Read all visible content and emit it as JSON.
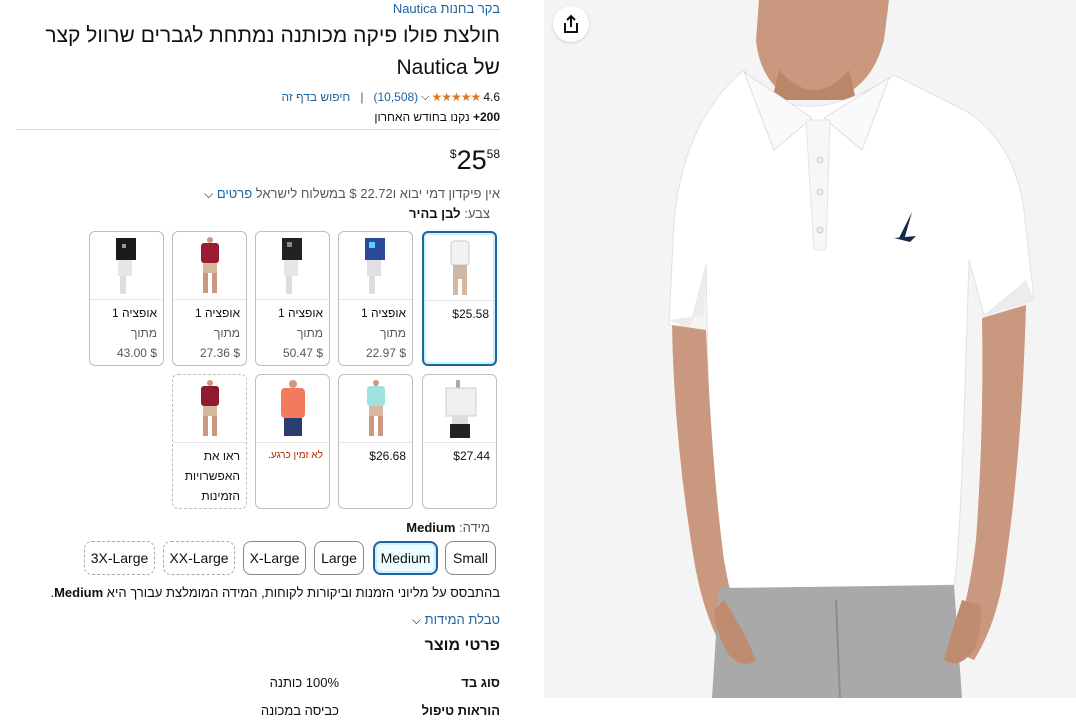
{
  "breadcrumb": {
    "brand_link": "בקר בחנות Nautica"
  },
  "product": {
    "title": "חולצת פולו פיקה מכותנה נמתחת לגברים שרוול קצר של Nautica",
    "rating": "4.6",
    "review_count": "(10,508)",
    "search_page": "חיפוש בדף זה",
    "bought_bold": "200+",
    "bought_rest": " נקנו בחודש האחרון"
  },
  "price": {
    "symbol": "$",
    "whole": "25",
    "fraction": "58"
  },
  "shipping": {
    "text": "אין פיקדון דמי יבוא ו‎22.72 $ במשלוח לישראל ",
    "details_link": "פרטים"
  },
  "color": {
    "label": "צבע: ",
    "value": "לבן בהיר"
  },
  "swatches": [
    {
      "kind": "selected",
      "price": "$25.58",
      "img": "white-shirt"
    },
    {
      "kind": "option",
      "line1": "אופציה 1",
      "line2": "מתוך",
      "line3": "$ 22.97",
      "img": "blue-check"
    },
    {
      "kind": "option",
      "line1": "אופציה 1",
      "line2": "מתוך",
      "line3": "$ 50.47",
      "img": "black-check"
    },
    {
      "kind": "option",
      "line1": "אופציה 1",
      "line2": "מתוך",
      "line3": "$ 27.36",
      "img": "maroon-shirt"
    },
    {
      "kind": "option",
      "line1": "אופציה 1",
      "line2": "מתוך",
      "line3": "$ 43.00",
      "img": "black-check2"
    },
    {
      "kind": "price",
      "price": "$27.44",
      "img": "gray-black"
    },
    {
      "kind": "price",
      "price": "$26.68",
      "img": "aqua-shirt"
    },
    {
      "kind": "unavailable",
      "note": "לא זמין כרגע.",
      "img": "coral-shirt"
    },
    {
      "kind": "more",
      "line1": "ראו את",
      "line2": "האפשרויות",
      "line3": "הזמינות",
      "img": "maroon-shirt2"
    }
  ],
  "size": {
    "label": "מידה: ",
    "value": "Medium",
    "options": [
      "Small",
      "Medium",
      "Large",
      "X-Large",
      "XX-Large",
      "3X-Large"
    ],
    "recommendation": "בהתבסס על מליוני הזמנות וביקורות לקוחות, המידה המומלצת עבורך היא ",
    "recommended": "Medium",
    "size_chart": "טבלת המידות"
  },
  "details": {
    "heading": "פרטי מוצר",
    "rows": [
      {
        "key": "סוג בד",
        "value": "100% כותנה"
      },
      {
        "key": "הוראות טיפול",
        "value": "כביסה במכונה"
      }
    ]
  },
  "colors": {
    "link": "#2162a1",
    "star": "#de7921",
    "selected_border": "#2162a1"
  }
}
